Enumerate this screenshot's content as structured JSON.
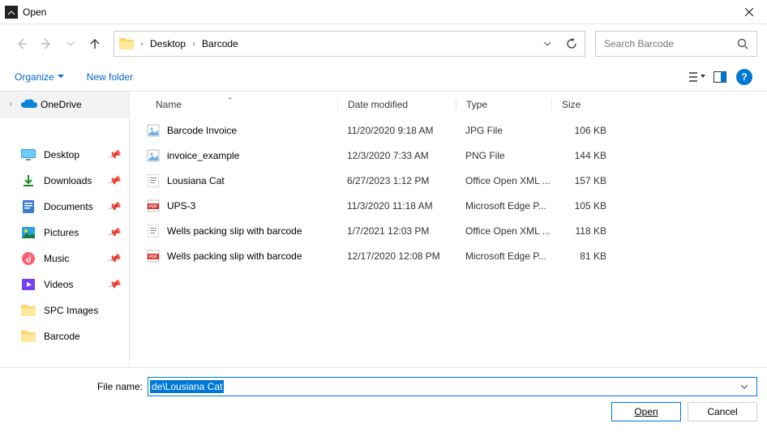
{
  "title": "Open",
  "breadcrumb": {
    "items": [
      "Desktop",
      "Barcode"
    ]
  },
  "search": {
    "placeholder": "Search Barcode"
  },
  "commands": {
    "organize": "Organize",
    "newfolder": "New folder"
  },
  "sidebar": {
    "top": {
      "label": "OneDrive"
    },
    "items": [
      {
        "label": "Desktop",
        "pinned": true,
        "icon": "desktop"
      },
      {
        "label": "Downloads",
        "pinned": true,
        "icon": "download"
      },
      {
        "label": "Documents",
        "pinned": true,
        "icon": "document"
      },
      {
        "label": "Pictures",
        "pinned": true,
        "icon": "pictures"
      },
      {
        "label": "Music",
        "pinned": true,
        "icon": "music"
      },
      {
        "label": "Videos",
        "pinned": true,
        "icon": "videos"
      },
      {
        "label": "SPC Images",
        "pinned": false,
        "icon": "folder"
      },
      {
        "label": "Barcode",
        "pinned": false,
        "icon": "folder"
      }
    ]
  },
  "columns": {
    "name": "Name",
    "date": "Date modified",
    "type": "Type",
    "size": "Size"
  },
  "files": [
    {
      "name": "Barcode Invoice",
      "date": "11/20/2020 9:18 AM",
      "type": "JPG File",
      "size": "106 KB",
      "icon": "image"
    },
    {
      "name": "invoice_example",
      "date": "12/3/2020 7:33 AM",
      "type": "PNG File",
      "size": "144 KB",
      "icon": "image"
    },
    {
      "name": "Lousiana Cat",
      "date": "6/27/2023 1:12 PM",
      "type": "Office Open XML ...",
      "size": "157 KB",
      "icon": "doc"
    },
    {
      "name": "UPS-3",
      "date": "11/3/2020 11:18 AM",
      "type": "Microsoft Edge P...",
      "size": "105 KB",
      "icon": "pdf"
    },
    {
      "name": "Wells packing slip with barcode",
      "date": "1/7/2021 12:03 PM",
      "type": "Office Open XML ...",
      "size": "118 KB",
      "icon": "doc"
    },
    {
      "name": "Wells packing slip with barcode",
      "date": "12/17/2020 12:08 PM",
      "type": "Microsoft Edge P...",
      "size": "81 KB",
      "icon": "pdf"
    }
  ],
  "filename": {
    "label": "File name:",
    "value": "de\\Lousiana Cat"
  },
  "buttons": {
    "open": "Open",
    "cancel": "Cancel"
  }
}
